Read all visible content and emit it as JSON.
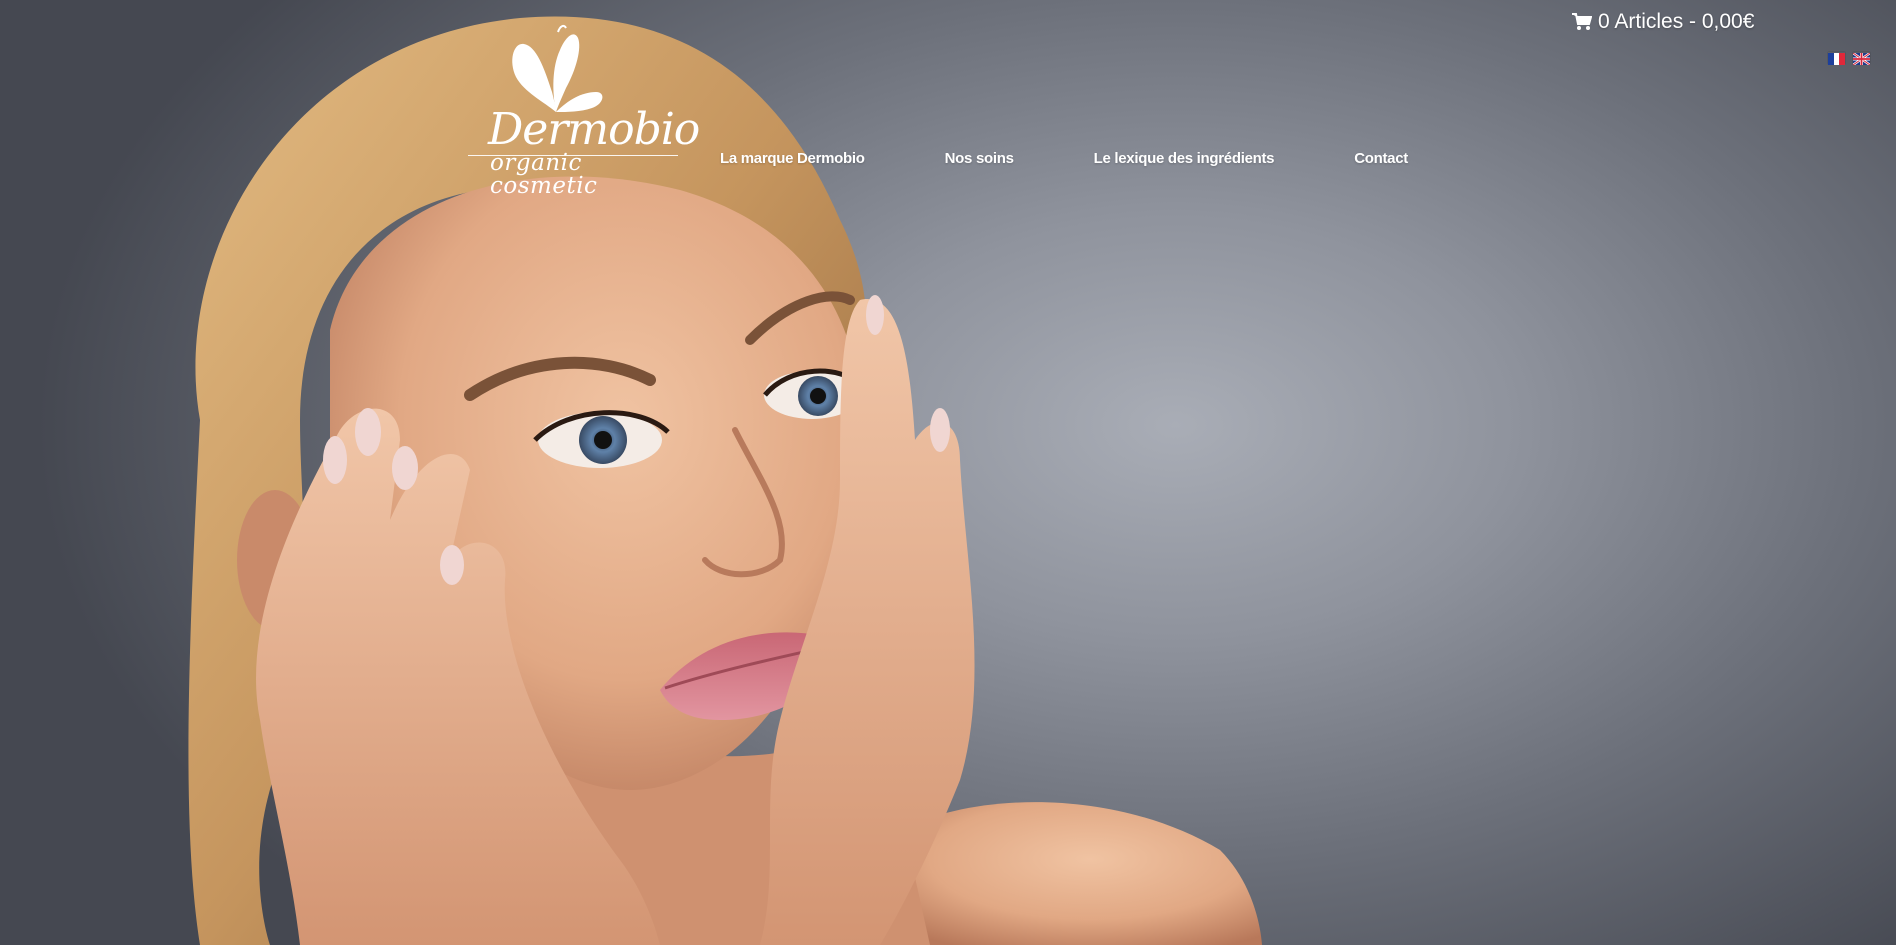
{
  "header": {
    "cart": {
      "icon": "shopping-cart-icon",
      "label": "0 Articles - 0,00€"
    },
    "languages": [
      {
        "icon": "french-flag-icon",
        "code": "fr"
      },
      {
        "icon": "english-flag-icon",
        "code": "en"
      }
    ]
  },
  "logo": {
    "icon": "butterfly-icon",
    "brand": "Dermobio",
    "tagline": "organic cosmetic"
  },
  "nav": {
    "items": [
      {
        "label": "La marque Dermobio"
      },
      {
        "label": "Nos soins"
      },
      {
        "label": "Le lexique des ingrédients"
      },
      {
        "label": "Contact"
      }
    ]
  },
  "colors": {
    "text": "#ffffff",
    "background": "#8f939d",
    "skin": "#e2aa88",
    "hair": "#c99a62",
    "lips": "#d97b86"
  }
}
